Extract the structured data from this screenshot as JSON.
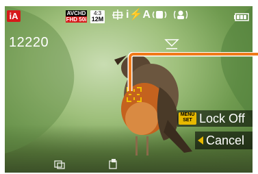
{
  "header": {
    "mode_label": "iA",
    "rec_format_top": "AVCHD",
    "rec_format_bottom": "FHD 50i",
    "aspect_ratio": "4:3",
    "picture_size": "12M",
    "flash_label": "i⚡A"
  },
  "shots_remaining": "12220",
  "af_lock": {
    "menu_badge_line1": "MENU",
    "menu_badge_line2": "SET",
    "lock_label": "Lock Off"
  },
  "cancel": {
    "label": "Cancel"
  },
  "icons": [
    "intelligent-auto-icon",
    "grid-icon",
    "flash-icon",
    "stabilizer-icon",
    "face-detect-icon",
    "battery-icon",
    "af-area-marker-icon",
    "back-arrow-icon",
    "wide-icon",
    "zoom-icon"
  ],
  "colors": {
    "accent_yellow": "#e6b800",
    "mode_red": "#d61a1a",
    "callout_orange": "#f07a1a"
  }
}
